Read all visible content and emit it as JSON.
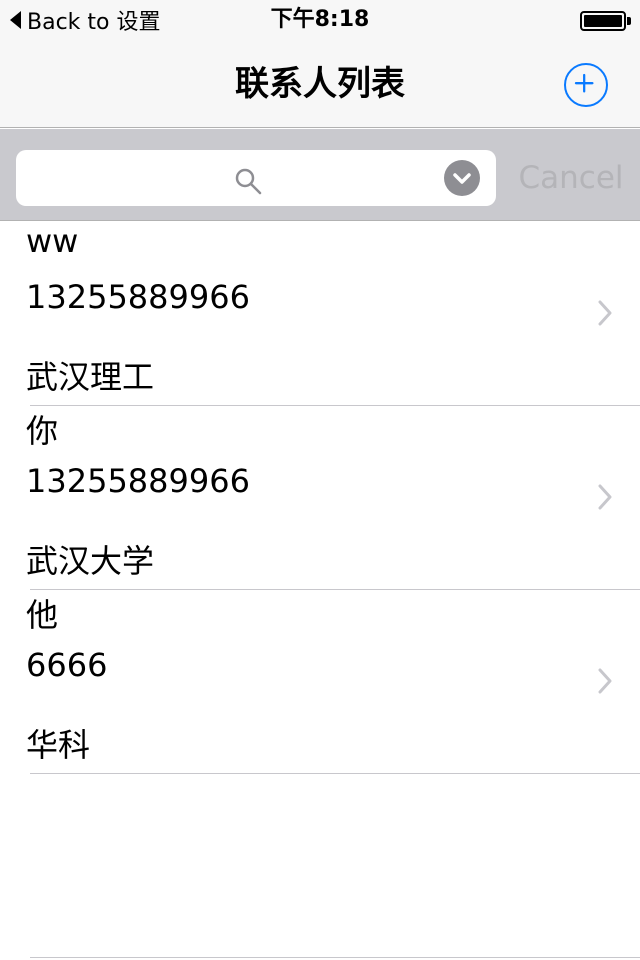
{
  "status_bar": {
    "back_label": "Back to 设置",
    "time": "下午8:18",
    "battery_level": 1.0
  },
  "nav_bar": {
    "title": "联系人列表",
    "add_icon": "plus-circle-icon"
  },
  "search": {
    "value": "",
    "placeholder": "",
    "search_icon": "magnifier-icon",
    "dropdown_icon": "chevron-down-circle-icon",
    "cancel_label": "Cancel"
  },
  "contacts": [
    {
      "name": "ww",
      "phone": "13255889966",
      "org": "武汉理工"
    },
    {
      "name": "你",
      "phone": "13255889966",
      "org": "武汉大学"
    },
    {
      "name": "他",
      "phone": "6666",
      "org": "华科"
    }
  ],
  "colors": {
    "accent": "#0a7aff",
    "bar_background": "#f7f7f7",
    "search_bar_background": "#c9c9ce",
    "separator": "#c8c7cc",
    "disclosure": "#c7c7cc",
    "cancel_disabled": "#b4b4b8"
  }
}
